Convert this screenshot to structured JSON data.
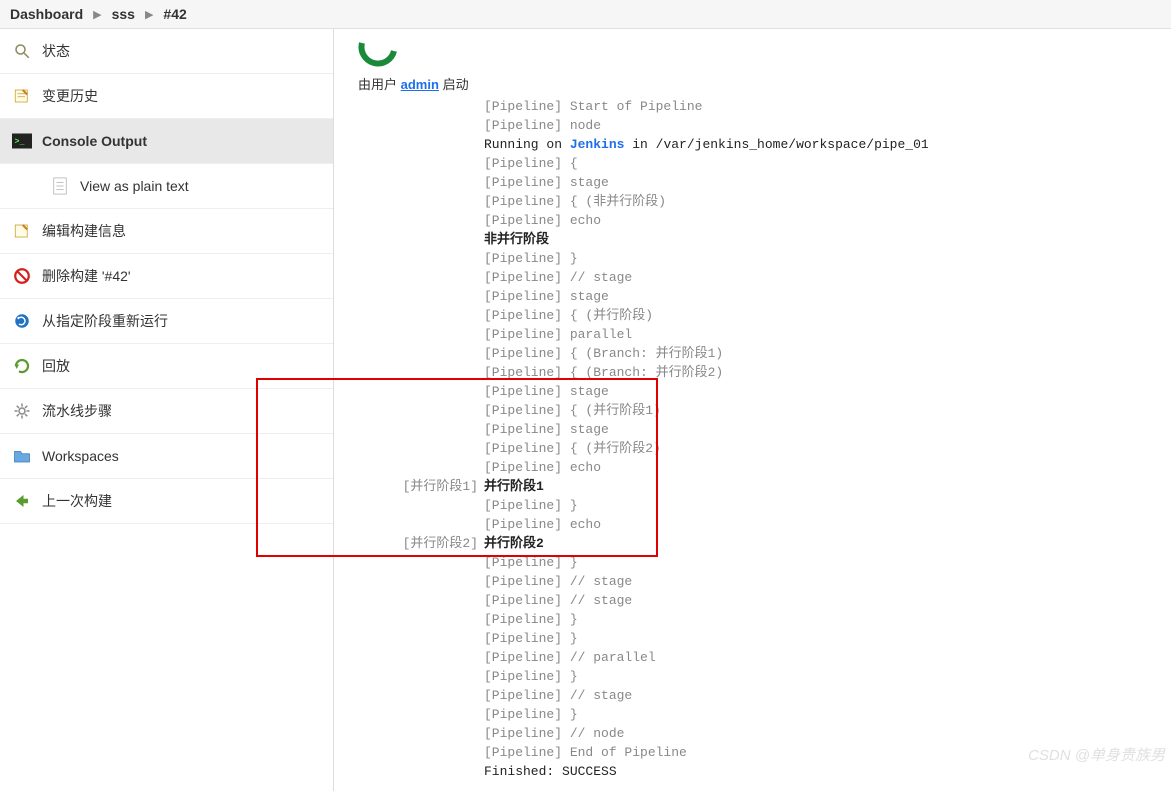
{
  "breadcrumb": {
    "dashboard": "Dashboard",
    "job": "sss",
    "build": "#42"
  },
  "sidebar": {
    "items": [
      {
        "label": "状态"
      },
      {
        "label": "变更历史"
      },
      {
        "label": "Console Output"
      },
      {
        "label": "View as plain text"
      },
      {
        "label": "编辑构建信息"
      },
      {
        "label": "删除构建 '#42'"
      },
      {
        "label": "从指定阶段重新运行"
      },
      {
        "label": "回放"
      },
      {
        "label": "流水线步骤"
      },
      {
        "label": "Workspaces"
      },
      {
        "label": "上一次构建"
      }
    ]
  },
  "started": {
    "prefix": "由用户",
    "user": "admin",
    "suffix": "启动"
  },
  "lines": [
    {
      "p": "",
      "t": "[Pipeline] Start of Pipeline"
    },
    {
      "p": "",
      "t": "[Pipeline] node"
    },
    {
      "p": "",
      "t": "Running on ",
      "tlink": "Jenkins",
      "t2": " in /var/jenkins_home/workspace/pipe_01",
      "run": true
    },
    {
      "p": "",
      "t": "[Pipeline] {"
    },
    {
      "p": "",
      "t": "[Pipeline] stage"
    },
    {
      "p": "",
      "t": "[Pipeline] { (非并行阶段)"
    },
    {
      "p": "",
      "t": "[Pipeline] echo"
    },
    {
      "p": "",
      "t": "非并行阶段",
      "b": true
    },
    {
      "p": "",
      "t": "[Pipeline] }"
    },
    {
      "p": "",
      "t": "[Pipeline] // stage"
    },
    {
      "p": "",
      "t": "[Pipeline] stage"
    },
    {
      "p": "",
      "t": "[Pipeline] { (并行阶段)"
    },
    {
      "p": "",
      "t": "[Pipeline] parallel"
    },
    {
      "p": "",
      "t": "[Pipeline] { (Branch: 并行阶段1)"
    },
    {
      "p": "",
      "t": "[Pipeline] { (Branch: 并行阶段2)"
    },
    {
      "p": "",
      "t": "[Pipeline] stage"
    },
    {
      "p": "",
      "t": "[Pipeline] { (并行阶段1)"
    },
    {
      "p": "",
      "t": "[Pipeline] stage"
    },
    {
      "p": "",
      "t": "[Pipeline] { (并行阶段2)"
    },
    {
      "p": "",
      "t": "[Pipeline] echo"
    },
    {
      "p": "[并行阶段1]",
      "t": "并行阶段1",
      "b": true
    },
    {
      "p": "",
      "t": "[Pipeline] }"
    },
    {
      "p": "",
      "t": "[Pipeline] echo"
    },
    {
      "p": "[并行阶段2]",
      "t": "并行阶段2",
      "b": true
    },
    {
      "p": "",
      "t": "[Pipeline] }"
    },
    {
      "p": "",
      "t": "[Pipeline] // stage"
    },
    {
      "p": "",
      "t": "[Pipeline] // stage"
    },
    {
      "p": "",
      "t": "[Pipeline] }"
    },
    {
      "p": "",
      "t": "[Pipeline] }"
    },
    {
      "p": "",
      "t": "[Pipeline] // parallel"
    },
    {
      "p": "",
      "t": "[Pipeline] }"
    },
    {
      "p": "",
      "t": "[Pipeline] // stage"
    },
    {
      "p": "",
      "t": "[Pipeline] }"
    },
    {
      "p": "",
      "t": "[Pipeline] // node"
    },
    {
      "p": "",
      "t": "[Pipeline] End of Pipeline"
    },
    {
      "p": "",
      "t": "Finished: SUCCESS",
      "run": true
    }
  ],
  "watermark": "CSDN @单身贵族男"
}
